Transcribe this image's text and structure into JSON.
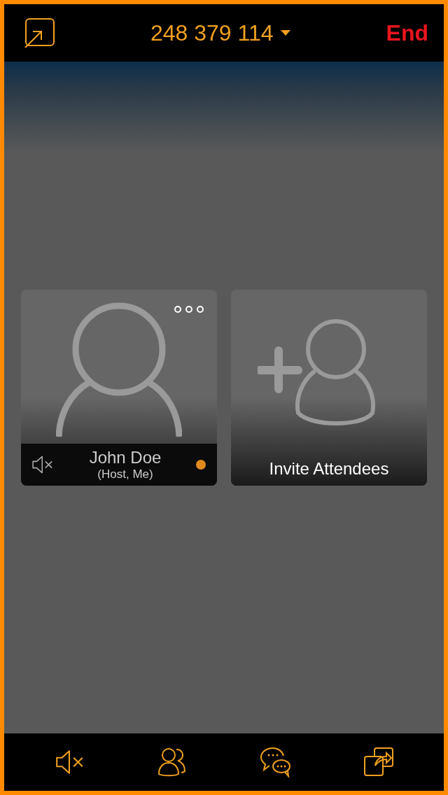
{
  "top_bar": {
    "meeting_number": "248 379 114",
    "end_label": "End"
  },
  "tiles": [
    {
      "kind": "attendee",
      "name": "John Doe",
      "role": "(Host, Me)",
      "muted": true,
      "active": true
    },
    {
      "kind": "invite",
      "label": "Invite Attendees"
    }
  ],
  "toolbar": [
    {
      "kind": "mute"
    },
    {
      "kind": "participants"
    },
    {
      "kind": "chat"
    },
    {
      "kind": "share"
    }
  ]
}
